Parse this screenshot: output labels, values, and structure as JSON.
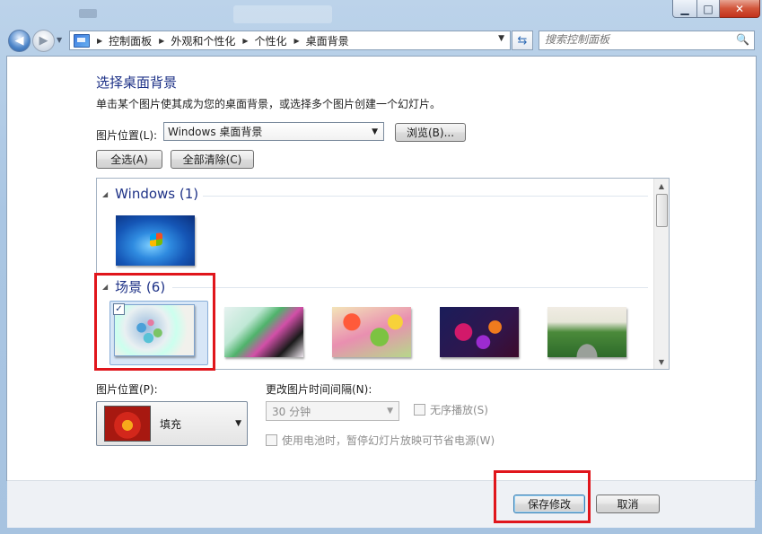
{
  "window": {
    "minimize_glyph": "▁",
    "maximize_glyph": "□",
    "close_glyph": "✕"
  },
  "breadcrumb": {
    "items": [
      "控制面板",
      "外观和个性化",
      "个性化",
      "桌面背景"
    ]
  },
  "search": {
    "placeholder": "搜索控制面板"
  },
  "page": {
    "heading": "选择桌面背景",
    "subtitle": "单击某个图片使其成为您的桌面背景，或选择多个图片创建一个幻灯片。",
    "location_label": "图片位置(L):",
    "location_value": "Windows 桌面背景",
    "browse_label": "浏览(B)...",
    "select_all_label": "全选(A)",
    "clear_all_label": "全部清除(C)"
  },
  "gallery": {
    "groups": [
      {
        "title": "Windows (1)",
        "thumbnails": [
          "windows7-logo"
        ]
      },
      {
        "title": "场景 (6)",
        "thumbnails": [
          "scene-1",
          "scene-2",
          "scene-3",
          "scene-4",
          "scene-5"
        ],
        "selected_index": 0
      }
    ],
    "checkmark": "✓"
  },
  "position": {
    "label": "图片位置(P):",
    "value": "填充"
  },
  "interval": {
    "label": "更改图片时间间隔(N):",
    "value": "30 分钟",
    "shuffle_label": "无序播放(S)",
    "battery_label": "使用电池时，暂停幻灯片放映可节省电源(W)"
  },
  "footer": {
    "save_label": "保存修改",
    "cancel_label": "取消"
  },
  "colors": {
    "heading": "#1e3287",
    "highlight": "#e0161c",
    "selection": "#d7e6f7"
  },
  "icons": [
    "back-arrow-icon",
    "forward-arrow-icon",
    "control-panel-icon",
    "chevron-right-icon",
    "refresh-icon",
    "search-icon",
    "dropdown-arrow-icon",
    "collapse-triangle-icon"
  ]
}
